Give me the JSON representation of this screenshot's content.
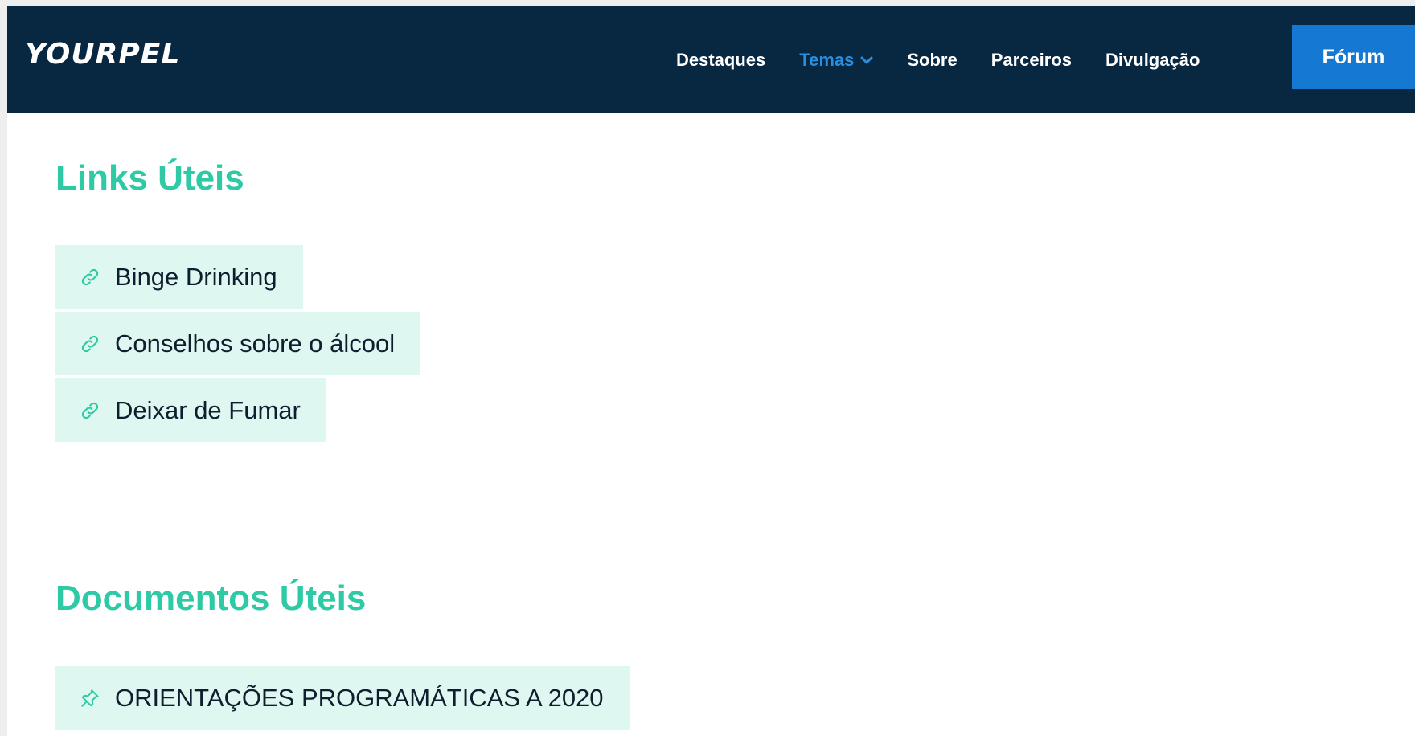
{
  "header": {
    "logo": "YOURPEL",
    "nav": [
      {
        "label": "Destaques"
      },
      {
        "label": "Temas",
        "active": true
      },
      {
        "label": "Sobre"
      },
      {
        "label": "Parceiros"
      },
      {
        "label": "Divulgação"
      }
    ],
    "forum_label": "Fórum"
  },
  "links_section": {
    "title": "Links Úteis",
    "items": [
      {
        "label": "Binge Drinking",
        "icon": "link-icon"
      },
      {
        "label": "Conselhos sobre o álcool",
        "icon": "link-icon"
      },
      {
        "label": "Deixar de Fumar",
        "icon": "link-icon"
      }
    ]
  },
  "documents_section": {
    "title": "Documentos Úteis",
    "items": [
      {
        "label": "ORIENTAÇÕES PROGRAMÁTICAS A 2020",
        "icon": "pin-icon"
      }
    ]
  },
  "colors": {
    "navbar": "#082740",
    "accent": "#2ecaa5",
    "active_nav": "#2a8ee0",
    "forum_button": "#1579d3",
    "item_bg": "#dff7f1"
  }
}
